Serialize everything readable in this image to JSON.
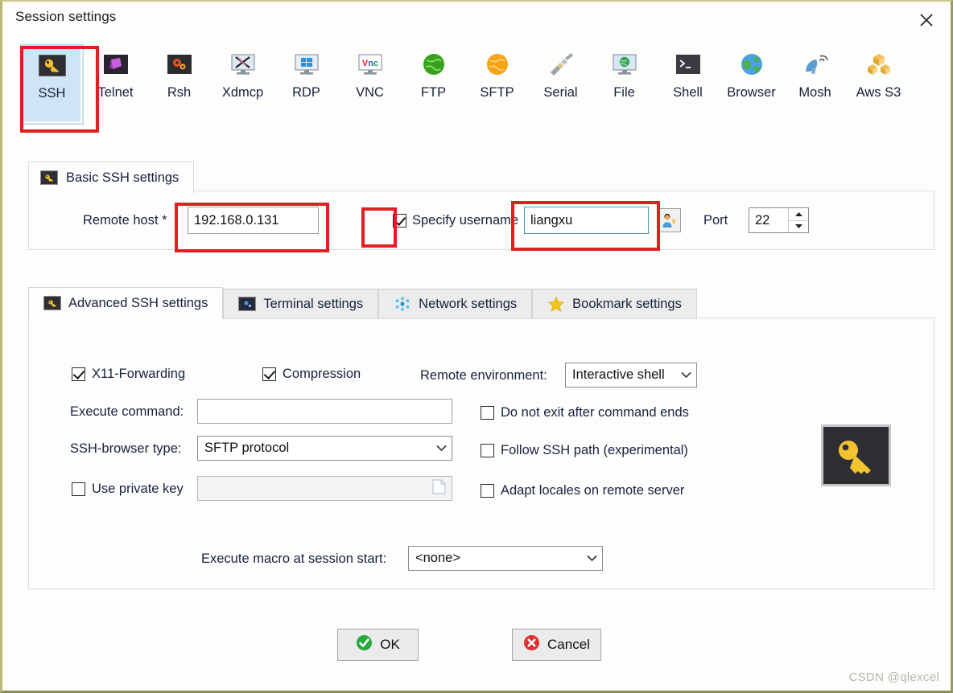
{
  "window": {
    "title": "Session settings",
    "close_icon": "close-icon"
  },
  "protocols": [
    {
      "label": "SSH",
      "icon": "ssh-key-icon",
      "selected": true
    },
    {
      "label": "Telnet",
      "icon": "telnet-icon",
      "selected": false
    },
    {
      "label": "Rsh",
      "icon": "rsh-gears-icon",
      "selected": false
    },
    {
      "label": "Xdmcp",
      "icon": "xdmcp-icon",
      "selected": false
    },
    {
      "label": "RDP",
      "icon": "rdp-windows-icon",
      "selected": false
    },
    {
      "label": "VNC",
      "icon": "vnc-icon",
      "selected": false
    },
    {
      "label": "FTP",
      "icon": "ftp-globe-icon",
      "selected": false
    },
    {
      "label": "SFTP",
      "icon": "sftp-globe-icon",
      "selected": false
    },
    {
      "label": "Serial",
      "icon": "serial-plug-icon",
      "selected": false
    },
    {
      "label": "File",
      "icon": "file-share-icon",
      "selected": false
    },
    {
      "label": "Shell",
      "icon": "shell-prompt-icon",
      "selected": false
    },
    {
      "label": "Browser",
      "icon": "browser-globe-icon",
      "selected": false
    },
    {
      "label": "Mosh",
      "icon": "mosh-dish-icon",
      "selected": false
    },
    {
      "label": "Aws S3",
      "icon": "aws-s3-icon",
      "selected": false
    }
  ],
  "basic": {
    "legend": "Basic SSH settings",
    "legend_icon": "ssh-key-icon",
    "remote_host_label": "Remote host *",
    "remote_host_value": "192.168.0.131",
    "remote_host_placeholder": "",
    "specify_username_label": "Specify username",
    "specify_username_checked": true,
    "username_value": "liangxu",
    "username_placeholder": "",
    "user_picker_icon": "user-avatar-icon",
    "port_label": "Port",
    "port_value": "22",
    "spinner_up_icon": "chevron-up-icon",
    "spinner_down_icon": "chevron-down-icon"
  },
  "tabs": [
    {
      "label": "Advanced SSH settings",
      "icon": "ssh-key-icon",
      "active": true
    },
    {
      "label": "Terminal settings",
      "icon": "terminal-icon",
      "active": false
    },
    {
      "label": "Network settings",
      "icon": "network-icon",
      "active": false
    },
    {
      "label": "Bookmark settings",
      "icon": "star-icon",
      "active": false
    }
  ],
  "advanced": {
    "x11_label": "X11-Forwarding",
    "x11_checked": true,
    "compression_label": "Compression",
    "compression_checked": true,
    "remote_env_label": "Remote environment:",
    "remote_env_value": "Interactive shell",
    "execute_command_label": "Execute command:",
    "execute_command_value": "",
    "do_not_exit_label": "Do not exit after command ends",
    "do_not_exit_checked": false,
    "ssh_browser_label": "SSH-browser type:",
    "ssh_browser_value": "SFTP protocol",
    "follow_ssh_label": "Follow SSH path (experimental)",
    "follow_ssh_checked": false,
    "use_private_key_label": "Use private key",
    "use_private_key_checked": false,
    "private_key_value": "",
    "private_key_browse_icon": "file-browse-icon",
    "adapt_locales_label": "Adapt locales on remote server",
    "adapt_locales_checked": false,
    "macro_label": "Execute macro at session start:",
    "macro_value": "<none>",
    "key_image_icon": "ssh-key-large-icon",
    "dropdown_icon": "chevron-down-icon"
  },
  "footer": {
    "ok_label": "OK",
    "ok_icon": "check-circle-icon",
    "cancel_label": "Cancel",
    "cancel_icon": "x-circle-icon"
  },
  "watermark": "CSDN @qlexcel",
  "colors": {
    "highlight": "#e02020",
    "selected_tab_bg": "#cfe4f5",
    "ok_green": "#28a745",
    "cancel_red": "#e03131"
  }
}
